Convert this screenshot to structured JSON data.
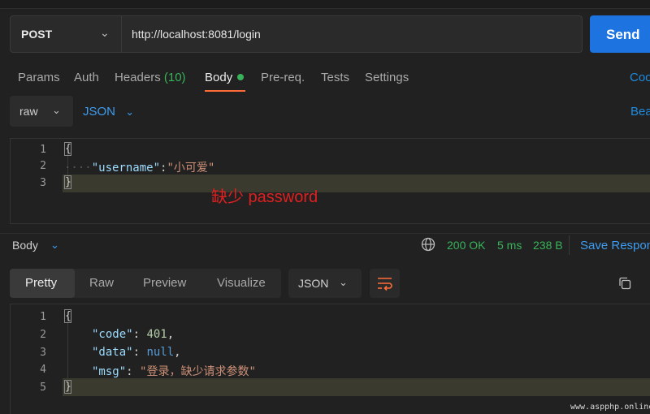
{
  "request": {
    "method": "POST",
    "url": "http://localhost:8081/login",
    "send_label": "Send"
  },
  "tabs": {
    "params": "Params",
    "auth": "Auth",
    "headers": "Headers",
    "headers_count": "(10)",
    "body": "Body",
    "prereq": "Pre-req.",
    "tests": "Tests",
    "settings": "Settings",
    "cookies": "Coo"
  },
  "body_options": {
    "mode": "raw",
    "language": "JSON",
    "beautify": "Bea"
  },
  "request_editor": {
    "line_numbers": [
      "1",
      "2",
      "3"
    ],
    "open_brace": "{",
    "indent_dots": "····",
    "key": "\"username\"",
    "colon": ":",
    "value": "\"小可爱\"",
    "close_brace": "}"
  },
  "annotation": "缺少 password",
  "response": {
    "section_label": "Body",
    "status": "200 OK",
    "time": "5 ms",
    "size": "238 B",
    "save_label": "Save Respon",
    "view_tabs": [
      "Pretty",
      "Raw",
      "Preview",
      "Visualize"
    ],
    "format": "JSON"
  },
  "response_editor": {
    "line_numbers": [
      "1",
      "2",
      "3",
      "4",
      "5"
    ],
    "open_brace": "{",
    "code_key": "\"code\"",
    "code_value": "401",
    "data_key": "\"data\"",
    "data_value": "null",
    "msg_key": "\"msg\"",
    "msg_value": "\"登录，缺少请求参数\"",
    "sep": ": ",
    "comma": ",",
    "close_brace": "}"
  },
  "watermark": "www.aspphp.online",
  "colors": {
    "accent_blue": "#1d74e0",
    "status_green": "#38b35a",
    "tab_underline": "#ff6c37",
    "annotation_red": "#e02020"
  },
  "icons": [
    "chevron-down-icon",
    "globe-icon",
    "wrap-lines-icon",
    "copy-icon"
  ]
}
